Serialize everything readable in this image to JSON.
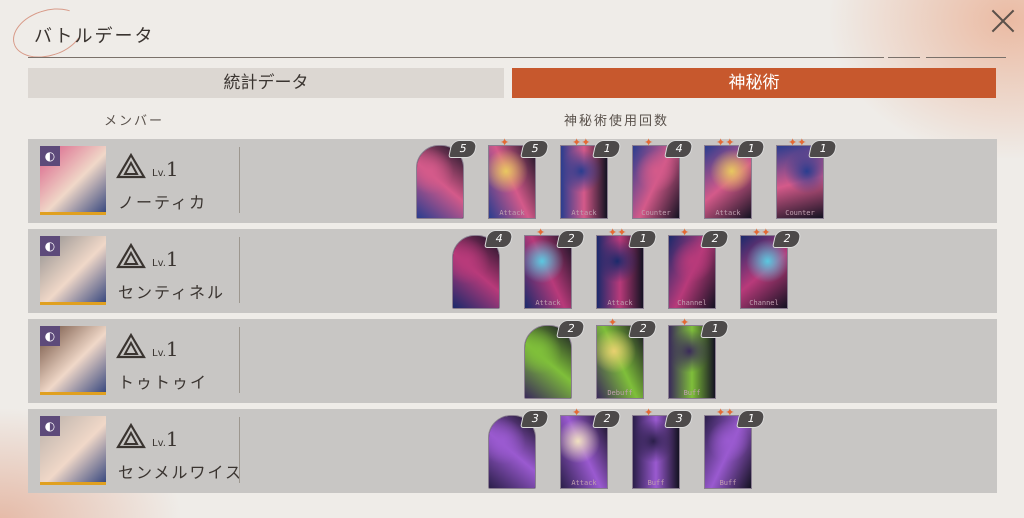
{
  "header": {
    "title": "バトルデータ"
  },
  "tabs": [
    {
      "label": "統計データ",
      "active": false
    },
    {
      "label": "神秘術",
      "active": true
    }
  ],
  "columns": {
    "member": "メンバー",
    "usage": "神秘術使用回数"
  },
  "colors": {
    "accent": "#c7582d",
    "row_bg": "#c8c6c4"
  },
  "members": [
    {
      "name": "ノーティカ",
      "lv_prefix": "Lv.",
      "level": "1",
      "portrait_hue": "#d85a86",
      "cards": [
        {
          "count": "5",
          "stars": "",
          "label": "",
          "arch": true
        },
        {
          "count": "5",
          "stars": "✦",
          "label": "Attack",
          "arch": false
        },
        {
          "count": "1",
          "stars": "✦✦",
          "label": "Attack",
          "arch": false
        },
        {
          "count": "4",
          "stars": "✦",
          "label": "Counter",
          "arch": false
        },
        {
          "count": "1",
          "stars": "✦✦",
          "label": "Attack",
          "arch": false
        },
        {
          "count": "1",
          "stars": "✦✦",
          "label": "Counter",
          "arch": false
        }
      ]
    },
    {
      "name": "センティネル",
      "lv_prefix": "Lv.",
      "level": "1",
      "portrait_hue": "#8d8d8d",
      "cards": [
        {
          "count": "4",
          "stars": "",
          "label": "",
          "arch": true
        },
        {
          "count": "2",
          "stars": "✦",
          "label": "Attack",
          "arch": false
        },
        {
          "count": "1",
          "stars": "✦✦",
          "label": "Attack",
          "arch": false
        },
        {
          "count": "2",
          "stars": "✦",
          "label": "Channel",
          "arch": false
        },
        {
          "count": "2",
          "stars": "✦✦",
          "label": "Channel",
          "arch": false
        }
      ]
    },
    {
      "name": "トゥトゥイ",
      "lv_prefix": "Lv.",
      "level": "1",
      "portrait_hue": "#6a4a3a",
      "cards": [
        {
          "count": "2",
          "stars": "",
          "label": "",
          "arch": true
        },
        {
          "count": "2",
          "stars": "✦",
          "label": "Debuff",
          "arch": false
        },
        {
          "count": "1",
          "stars": "✦",
          "label": "Buff",
          "arch": false
        }
      ]
    },
    {
      "name": "センメルワイス",
      "lv_prefix": "Lv.",
      "level": "1",
      "portrait_hue": "#b8b0aa",
      "cards": [
        {
          "count": "3",
          "stars": "",
          "label": "",
          "arch": true
        },
        {
          "count": "2",
          "stars": "✦",
          "label": "Attack",
          "arch": false
        },
        {
          "count": "3",
          "stars": "✦",
          "label": "Buff",
          "arch": false
        },
        {
          "count": "1",
          "stars": "✦✦",
          "label": "Buff",
          "arch": false
        }
      ]
    }
  ]
}
